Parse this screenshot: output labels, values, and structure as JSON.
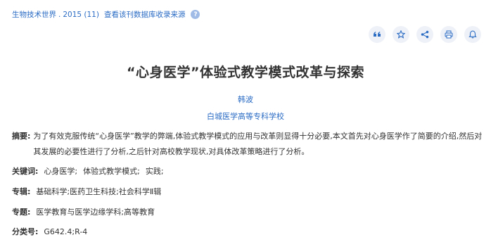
{
  "source": {
    "journal": "生物技术世界",
    "sep": ".",
    "issue": "2015 (11)",
    "db_link": "查看该刊数据库收录来源",
    "help": "?"
  },
  "toolbar": [
    {
      "name": "quote-button",
      "icon": "quote-icon"
    },
    {
      "name": "favorite-button",
      "icon": "star-icon"
    },
    {
      "name": "share-button",
      "icon": "share-icon"
    },
    {
      "name": "print-button",
      "icon": "printer-icon"
    },
    {
      "name": "notify-button",
      "icon": "bell-icon"
    }
  ],
  "article": {
    "title": "“心身医学”体验式教学模式改革与探索",
    "author": "韩波",
    "organization": "白城医学高等专科学校"
  },
  "abstract": {
    "label": "摘要:",
    "text": "为了有效克服传统“心身医学”教学的弊端,体验式教学模式的应用与改革则显得十分必要,本文首先对心身医学作了简要的介绍,然后对其发展的必要性进行了分析,之后针对高校教学现状,对具体改革策略进行了分析。"
  },
  "keywords": {
    "label": "关键词:",
    "items": [
      "心身医学;",
      "体验式教学模式;",
      "实践;"
    ]
  },
  "subject": {
    "label": "专辑:",
    "value": "基础科学;医药卫生科技;社会科学Ⅱ辑"
  },
  "topic": {
    "label": "专题:",
    "value": "医学教育与医学边缘学科;高等教育"
  },
  "clc": {
    "label": "分类号:",
    "value": "G642.4;R-4"
  },
  "colors": {
    "link": "#2b6cc4",
    "text": "#333333",
    "toolbar_bg": "#eef1f7"
  }
}
